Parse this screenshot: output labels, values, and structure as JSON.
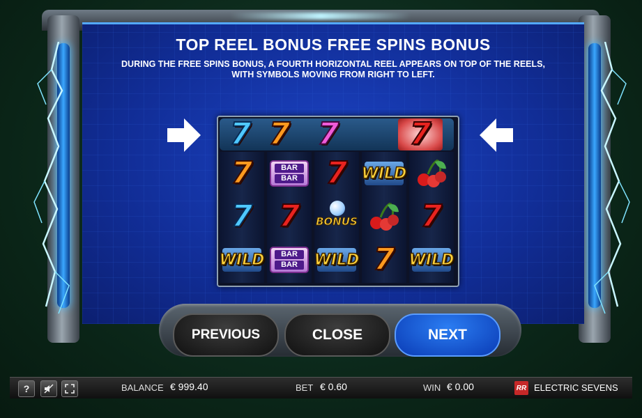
{
  "page": {
    "title": "TOP REEL BONUS FREE SPINS BONUS",
    "description": "DURING THE FREE SPINS BONUS, A FOURTH HORIZONTAL REEL APPEARS ON TOP OF THE REELS, WITH SYMBOLS MOVING FROM RIGHT TO LEFT."
  },
  "arrows": {
    "left_icon": "arrow-right-icon",
    "right_icon": "arrow-left-icon"
  },
  "top_reel": [
    {
      "symbol": "seven",
      "color": "blue",
      "text": "7"
    },
    {
      "symbol": "seven",
      "color": "orange",
      "text": "7"
    },
    {
      "symbol": "seven",
      "color": "pink",
      "text": "7"
    },
    {
      "symbol": "blank",
      "color": "",
      "text": ""
    },
    {
      "symbol": "seven",
      "color": "red",
      "text": "7",
      "highlighted": true
    }
  ],
  "reels": [
    [
      {
        "symbol": "seven",
        "color": "orange",
        "text": "7"
      },
      {
        "symbol": "seven",
        "color": "blue",
        "text": "7"
      },
      {
        "symbol": "wild",
        "text": "WILD"
      }
    ],
    [
      {
        "symbol": "barbar",
        "text": "BAR"
      },
      {
        "symbol": "seven",
        "color": "red",
        "text": "7"
      },
      {
        "symbol": "barbar",
        "text": "BAR"
      }
    ],
    [
      {
        "symbol": "seven",
        "color": "red",
        "text": "7"
      },
      {
        "symbol": "bonus",
        "text": "BONUS"
      },
      {
        "symbol": "wild",
        "text": "WILD"
      }
    ],
    [
      {
        "symbol": "wild",
        "text": "WILD"
      },
      {
        "symbol": "cherry",
        "text": ""
      },
      {
        "symbol": "seven",
        "color": "orange",
        "text": "7"
      }
    ],
    [
      {
        "symbol": "cherry",
        "text": ""
      },
      {
        "symbol": "seven",
        "color": "red",
        "text": "7"
      },
      {
        "symbol": "wild",
        "text": "WILD"
      }
    ]
  ],
  "buttons": {
    "previous": "PREVIOUS",
    "close": "CLOSE",
    "next": "NEXT"
  },
  "bottom_bar": {
    "help_label": "?",
    "sound_icon": "sound-off-icon",
    "fullscreen_icon": "fullscreen-icon",
    "balance_label": "BALANCE",
    "balance_value": "€ 999.40",
    "bet_label": "BET",
    "bet_value": "€ 0.60",
    "win_label": "WIN",
    "win_value": "€ 0.00",
    "logo_text": "RR",
    "game_name": "ELECTRIC SEVENS"
  },
  "colors": {
    "panel_blue": "#112d96",
    "next_button": "#0a3bb5",
    "seven_orange": "#ff9a1f",
    "seven_red": "#e8231f",
    "seven_blue": "#4fc8ff",
    "seven_pink": "#f05bd8",
    "wild_yellow": "#ffd23a"
  }
}
